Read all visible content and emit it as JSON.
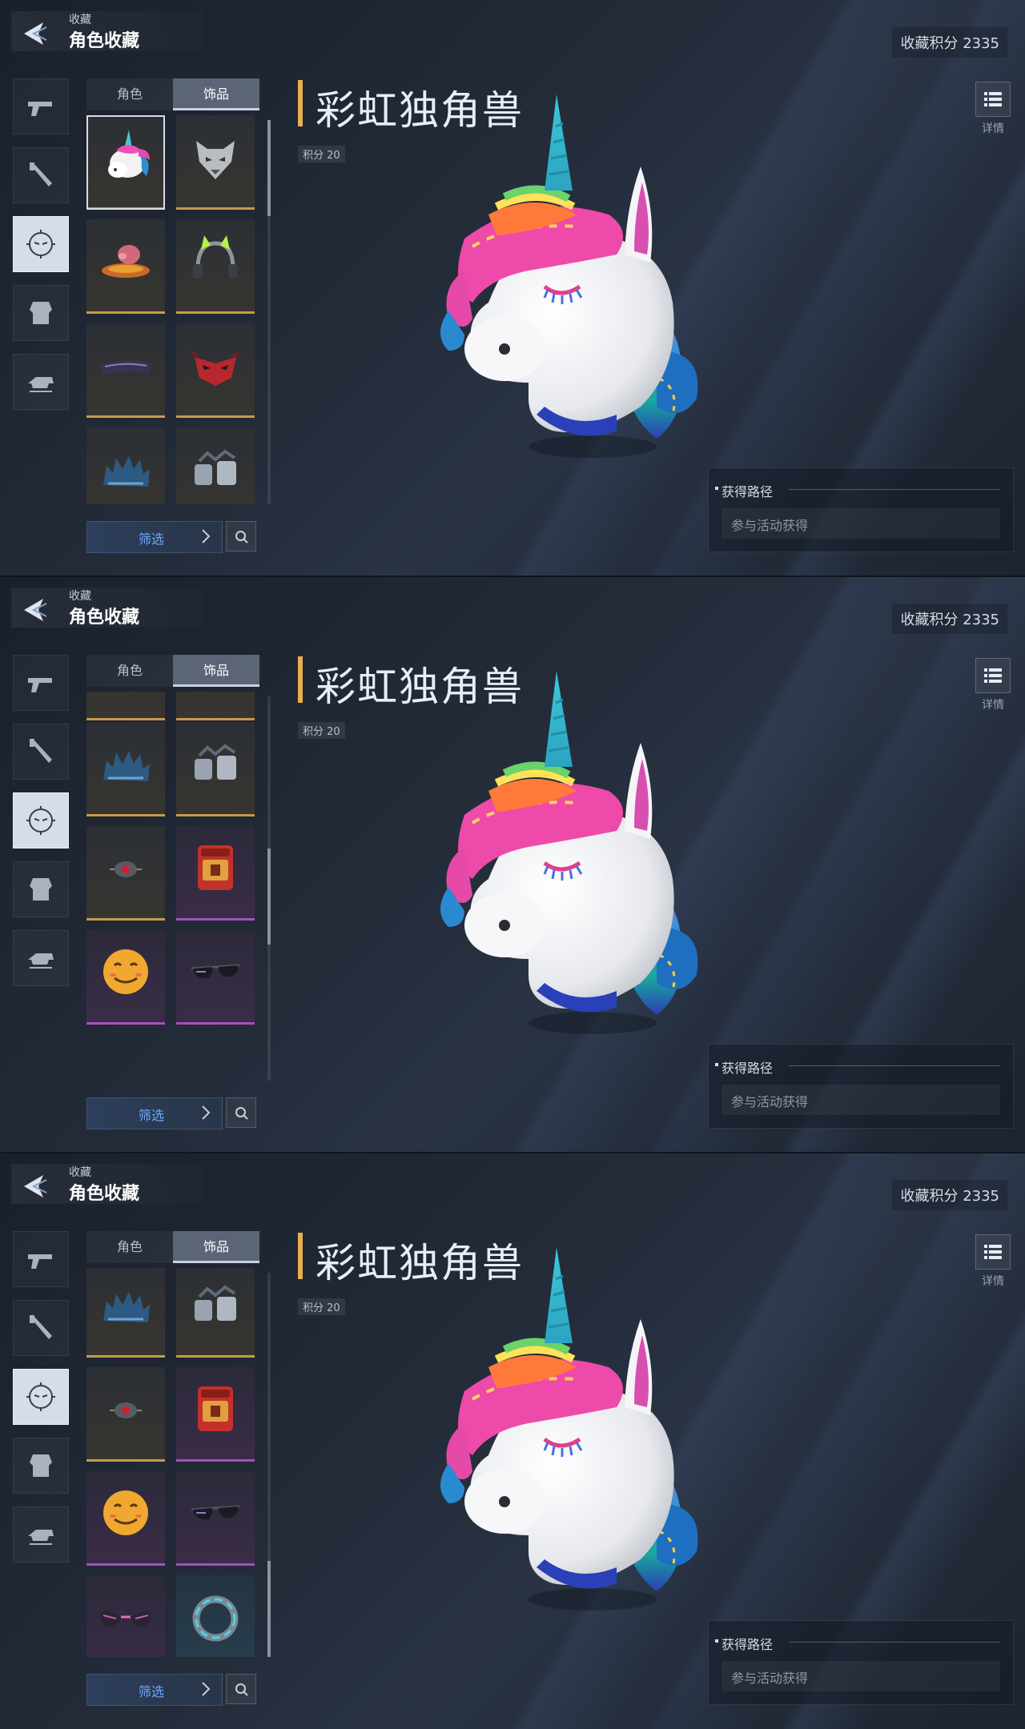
{
  "header": {
    "subtitle": "收藏",
    "title": "角色收藏",
    "score": "收藏积分 2335"
  },
  "tabs": [
    {
      "label": "角色"
    },
    {
      "label": "饰品"
    }
  ],
  "filter": {
    "label": "筛选"
  },
  "item": {
    "name": "彩虹独角兽",
    "points": "积分 20",
    "details_label": "详情",
    "source_title": "获得路径",
    "source_text": "参与活动获得"
  },
  "rail": [
    "pistol-icon",
    "melee-icon",
    "face-icon",
    "armor-icon",
    "vehicle-icon"
  ],
  "colors": {
    "accent": "#e8b04f",
    "gold_rarity": "#c79a4a",
    "purple_rarity": "#a64fc0",
    "teal_rarity": "#3aa3c2",
    "filter_text": "#6ea8ff"
  },
  "frames": [
    {
      "cells": [
        {
          "name": "unicorn-head-item",
          "rarity": "gold",
          "selected": true
        },
        {
          "name": "wolf-mask-item",
          "rarity": "gold"
        },
        {
          "name": "ufo-pig-item",
          "rarity": "gold"
        },
        {
          "name": "cat-ear-headphones-item",
          "rarity": "gold"
        },
        {
          "name": "dark-visor-item",
          "rarity": "gold"
        },
        {
          "name": "red-mask-item",
          "rarity": "gold"
        },
        {
          "name": "blue-spiked-armor-item",
          "rarity": "gold"
        },
        {
          "name": "silver-armor-item",
          "rarity": "gold"
        }
      ]
    },
    {
      "cells": [
        {
          "name": "partial-item-a",
          "rarity": "gold"
        },
        {
          "name": "partial-item-b",
          "rarity": "gold"
        },
        {
          "name": "blue-spiked-armor-item",
          "rarity": "gold"
        },
        {
          "name": "silver-armor-item",
          "rarity": "gold"
        },
        {
          "name": "red-eye-device-item",
          "rarity": "gold"
        },
        {
          "name": "red-backpack-item",
          "rarity": "purple"
        },
        {
          "name": "smiley-face-item",
          "rarity": "purple"
        },
        {
          "name": "sunglasses-item",
          "rarity": "purple"
        }
      ]
    },
    {
      "cells": [
        {
          "name": "blue-spiked-armor-item",
          "rarity": "gold"
        },
        {
          "name": "silver-armor-item",
          "rarity": "gold"
        },
        {
          "name": "red-eye-device-item",
          "rarity": "gold"
        },
        {
          "name": "red-backpack-item",
          "rarity": "purple"
        },
        {
          "name": "smiley-face-item",
          "rarity": "purple"
        },
        {
          "name": "sunglasses-item",
          "rarity": "purple"
        },
        {
          "name": "cat-eye-glasses-item",
          "rarity": "purple"
        },
        {
          "name": "cyan-ring-item",
          "rarity": "teal"
        }
      ]
    }
  ]
}
